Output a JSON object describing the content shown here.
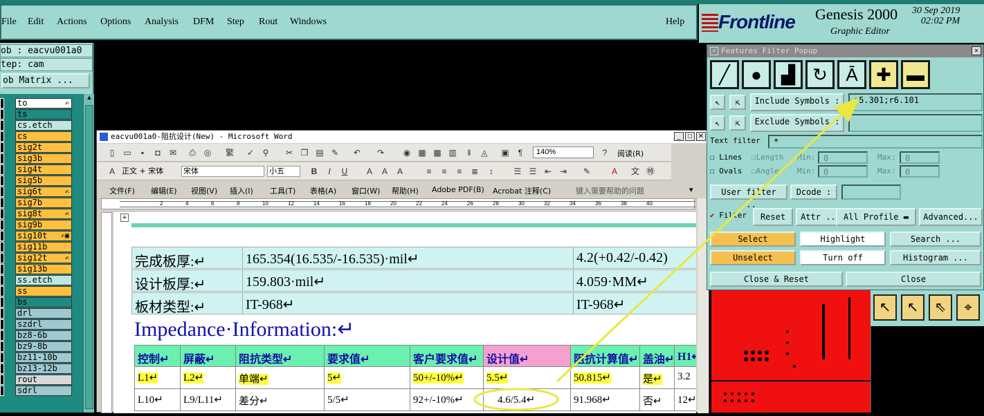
{
  "menubar": {
    "items": [
      "File",
      "Edit",
      "Actions",
      "Options",
      "Analysis",
      "DFM",
      "Step",
      "Rout",
      "Windows"
    ],
    "help": "Help"
  },
  "logo": {
    "brand": "Frontline",
    "product": "Genesis 2000",
    "subtitle": "Graphic Editor",
    "date": "30 Sep 2019",
    "time": "02:02 PM"
  },
  "left": {
    "job": "ob : eacvu001a0",
    "step": "tep: cam",
    "matrix_button": "ob Matrix ..."
  },
  "layers": [
    {
      "name": "to",
      "color": "#ffffff",
      "mark": "✍"
    },
    {
      "name": "ts",
      "color": "#1f8a7f",
      "mark": ""
    },
    {
      "name": "cs.etch",
      "color": "#bfe6e0",
      "mark": ""
    },
    {
      "name": "cs",
      "color": "#ffc040",
      "mark": ""
    },
    {
      "name": "sig2t",
      "color": "#ffc040",
      "mark": ""
    },
    {
      "name": "sig3b",
      "color": "#ffc040",
      "mark": ""
    },
    {
      "name": "sig4t",
      "color": "#ffc040",
      "mark": ""
    },
    {
      "name": "sig5b",
      "color": "#ffc040",
      "mark": ""
    },
    {
      "name": "sig6t",
      "color": "#ffc040",
      "mark": "✍"
    },
    {
      "name": "sig7b",
      "color": "#ffc040",
      "mark": ""
    },
    {
      "name": "sig8t",
      "color": "#ffc040",
      "mark": "✍"
    },
    {
      "name": "sig9b",
      "color": "#ffc040",
      "mark": ""
    },
    {
      "name": "sig10t",
      "color": "#ffc040",
      "mark": "✍▣"
    },
    {
      "name": "sig11b",
      "color": "#ffc040",
      "mark": ""
    },
    {
      "name": "sig12t",
      "color": "#ffc040",
      "mark": "✍"
    },
    {
      "name": "sig13b",
      "color": "#ffc040",
      "mark": ""
    },
    {
      "name": "ss.etch",
      "color": "#bfe6e0",
      "mark": ""
    },
    {
      "name": "ss",
      "color": "#ffc040",
      "mark": ""
    },
    {
      "name": "bs",
      "color": "#1f8a7f",
      "mark": ""
    },
    {
      "name": "drl",
      "color": "#9fc8d0",
      "mark": ""
    },
    {
      "name": "szdrl",
      "color": "#9fc8d0",
      "mark": ""
    },
    {
      "name": "bz8-6b",
      "color": "#9fc8d0",
      "mark": ""
    },
    {
      "name": "bz9-8b",
      "color": "#9fc8d0",
      "mark": ""
    },
    {
      "name": "bz11-10b",
      "color": "#9fc8d0",
      "mark": ""
    },
    {
      "name": "bz13-12b",
      "color": "#9fc8d0",
      "mark": ""
    },
    {
      "name": "rout",
      "color": "#d8d8d8",
      "mark": ""
    },
    {
      "name": "sdrl",
      "color": "#9fc8d0",
      "mark": ""
    }
  ],
  "word": {
    "title": "eacvu001a0-阻抗设计(New) - Microsoft Word",
    "zoom": "140%",
    "read_button": "阅读(R)",
    "style": "正文 + 宋体",
    "font": "宋体",
    "size": "小五",
    "menu": [
      "文件(F)",
      "编辑(E)",
      "视图(V)",
      "插入(I)",
      "工具(T)",
      "表格(A)",
      "窗口(W)",
      "帮助(H)",
      "Adobe PDF(B)",
      "Acrobat 注释(C)"
    ],
    "help_placeholder": "键入需要帮助的问题",
    "ruler_marks": [
      "2",
      "4",
      "6",
      "8",
      "10",
      "12",
      "14",
      "16",
      "18",
      "20",
      "22",
      "24",
      "26",
      "28",
      "30",
      "32",
      "34",
      "36",
      "38",
      "40"
    ],
    "board_rows": [
      {
        "label": "完成板厚:↵",
        "value": "165.354(16.535/-16.535)·mil↵",
        "metric": "4.2(+0.42/-0.42)"
      },
      {
        "label": "设计板厚:↵",
        "value": "159.803·mil↵",
        "metric": "4.059·MM↵"
      },
      {
        "label": "板材类型:↵",
        "value": "IT-968↵",
        "metric": "IT-968↵"
      }
    ],
    "impedance_heading": "Impedance·Information:↵",
    "table_headers": [
      "控制↵",
      "屏蔽↵",
      "阻抗类型↵",
      "要求值↵",
      "客户要求值↵",
      "设计值↵",
      "阻抗计算值↵",
      "盖油↵",
      "H1↵"
    ],
    "table_rows": [
      [
        "L1↵",
        "L2↵",
        "单端↵",
        "5↵",
        "50+/-10%↵",
        "5.5↵",
        "50.815↵",
        "是↵",
        "3.2"
      ],
      [
        "L10↵",
        "L9/L11↵",
        "差分↵",
        "5/5↵",
        "92+/-10%↵",
        "4.6/5.4↵",
        "91.968↵",
        "否↵",
        "12↵"
      ]
    ]
  },
  "ffp": {
    "title": "Features Filter Popup",
    "include_label": "Include Symbols :",
    "include_value": "r5.301;r6.101",
    "exclude_label": "Exclude Symbols :",
    "exclude_value": "",
    "text_filter_label": "Text filter",
    "text_filter_value": "*",
    "lines": "Lines",
    "ovals": "Ovals",
    "length": "Length",
    "angle": "Angle",
    "min": "Min:",
    "max": "Max:",
    "zero": "0",
    "user_filter": "User filter ...",
    "dcode": "Dcode :",
    "filter": "Filter",
    "reset": "Reset",
    "attr": "Attr ...",
    "all_profile": "All Profile",
    "advanced": "Advanced...",
    "select": "Select",
    "highlight": "Highlight",
    "search": "Search ...",
    "unselect": "Unselect",
    "turn_off": "Turn off",
    "histogram": "Histogram ...",
    "close_reset": "Close & Reset",
    "close": "Close"
  },
  "colors": {
    "panel": "#9fd8d0",
    "accent_yellow": "#ffff40",
    "board_red": "#f01010",
    "arrow": "#e8e840"
  }
}
